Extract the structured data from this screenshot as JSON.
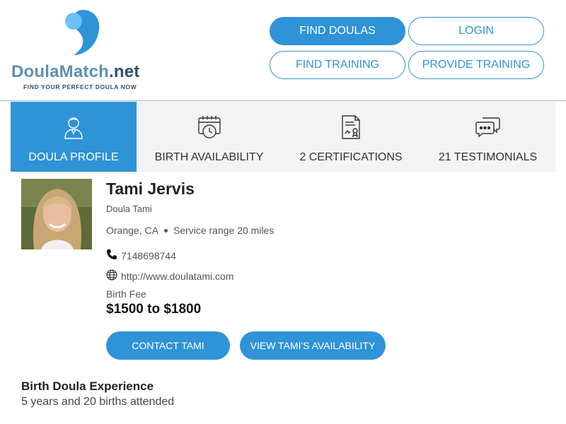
{
  "logo": {
    "brand_part1": "Doula",
    "brand_part2": "Match",
    "brand_part3": ".net",
    "tagline": "FIND YOUR PERFECT DOULA NOW"
  },
  "nav": {
    "find_doulas": "FIND DOULAS",
    "login": "LOGIN",
    "find_training": "FIND TRAINING",
    "provide_training": "PROVIDE TRAINING"
  },
  "tabs": [
    {
      "label": "DOULA PROFILE",
      "icon": "person-icon",
      "active": true
    },
    {
      "label": "BIRTH AVAILABILITY",
      "icon": "calendar-clock-icon",
      "active": false
    },
    {
      "label": "2 CERTIFICATIONS",
      "icon": "certificate-icon",
      "active": false
    },
    {
      "label": "21 TESTIMONIALS",
      "icon": "chat-bubbles-icon",
      "active": false
    }
  ],
  "profile": {
    "name": "Tami Jervis",
    "subtitle": "Doula Tami",
    "city": "Orange, CA",
    "service_range": "Service range 20 miles",
    "phone": "7148698744",
    "website": "http://www.doulatami.com",
    "fee_label": "Birth Fee",
    "fee_value": "$1500 to $1800"
  },
  "actions": {
    "contact": "CONTACT TAMI",
    "availability": "VIEW TAMI'S AVAILABILITY"
  },
  "experience": {
    "title": "Birth Doula Experience",
    "text": "5 years and 20 births attended"
  },
  "colors": {
    "accent": "#2f93d8",
    "logo_blue": "#5b8fb9",
    "logo_dark": "#2e4f6e"
  }
}
